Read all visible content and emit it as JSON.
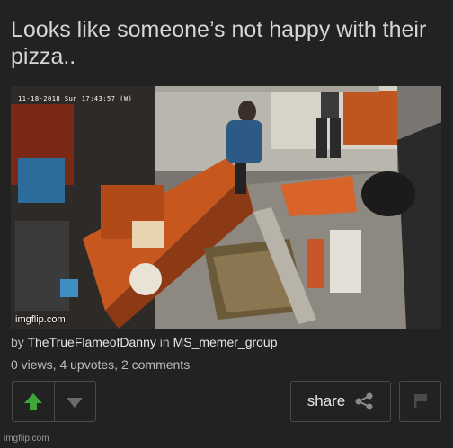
{
  "post": {
    "title": "Looks like someone’s not happy with their pizza..",
    "image_timestamp": "11-18-2018 Sun 17:43:57 (W)",
    "image_watermark": "imgflip.com",
    "byline_prefix": "by",
    "author": "TheTrueFlameofDanny",
    "in_text": "in",
    "group": "MS_memer_group",
    "stats": "0 views, 4 upvotes, 2 comments"
  },
  "actions": {
    "upvote_icon": "up-arrow-icon",
    "downvote_icon": "down-arrow-icon",
    "share_label": "share",
    "share_icon": "share-icon",
    "flag_icon": "flag-icon"
  },
  "footer": {
    "watermark": "imgflip.com"
  },
  "colors": {
    "background": "#222222",
    "upvote_active": "#3ca636",
    "border": "#4a4a4a"
  }
}
